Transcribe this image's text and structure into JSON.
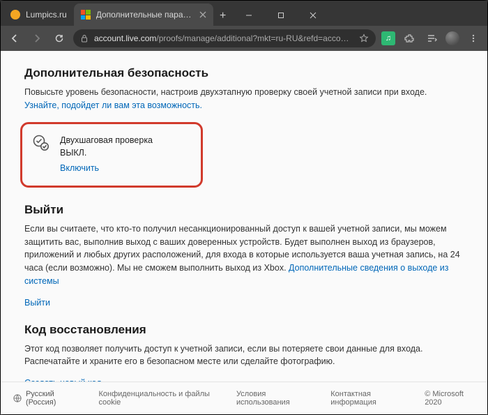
{
  "window": {
    "tabs": [
      {
        "label": "Lumpics.ru"
      },
      {
        "label": "Дополнительные параметры б…"
      }
    ]
  },
  "addressbar": {
    "host": "account.live.com",
    "path": "/proofs/manage/additional?mkt=ru-RU&refd=account.microsoft.com&refp=s…"
  },
  "sections": {
    "security": {
      "heading": "Дополнительная безопасность",
      "intro_before": "Повысьте уровень безопасности, настроив двухэтапную проверку своей учетной записи при входе. ",
      "intro_link": "Узнайте, подойдет ли вам эта возможность.",
      "card": {
        "title": "Двухшаговая проверка",
        "status": "ВЫКЛ.",
        "action": "Включить"
      }
    },
    "signout": {
      "heading": "Выйти",
      "body_before": "Если вы считаете, что кто-то получил несанкционированный доступ к вашей учетной записи, мы можем защитить вас, выполнив выход с ваших доверенных устройств. Будет выполнен выход из браузеров, приложений и любых других расположений, для входа в которые используется ваша учетная запись, на 24 часа (если возможно). Мы не сможем выполнить выход из Xbox. ",
      "body_link": "Дополнительные сведения о выходе из системы",
      "action": "Выйти"
    },
    "recovery": {
      "heading": "Код восстановления",
      "body": "Этот код позволяет получить доступ к учетной записи, если вы потеряете свои данные для входа. Распечатайте и храните его в безопасном месте или сделайте фотографию.",
      "action": "Создать новый код"
    }
  },
  "footer": {
    "language": "Русский (Россия)",
    "privacy": "Конфиденциальность и файлы cookie",
    "terms": "Условия использования",
    "contact": "Контактная информация",
    "copyright": "© Microsoft 2020"
  }
}
